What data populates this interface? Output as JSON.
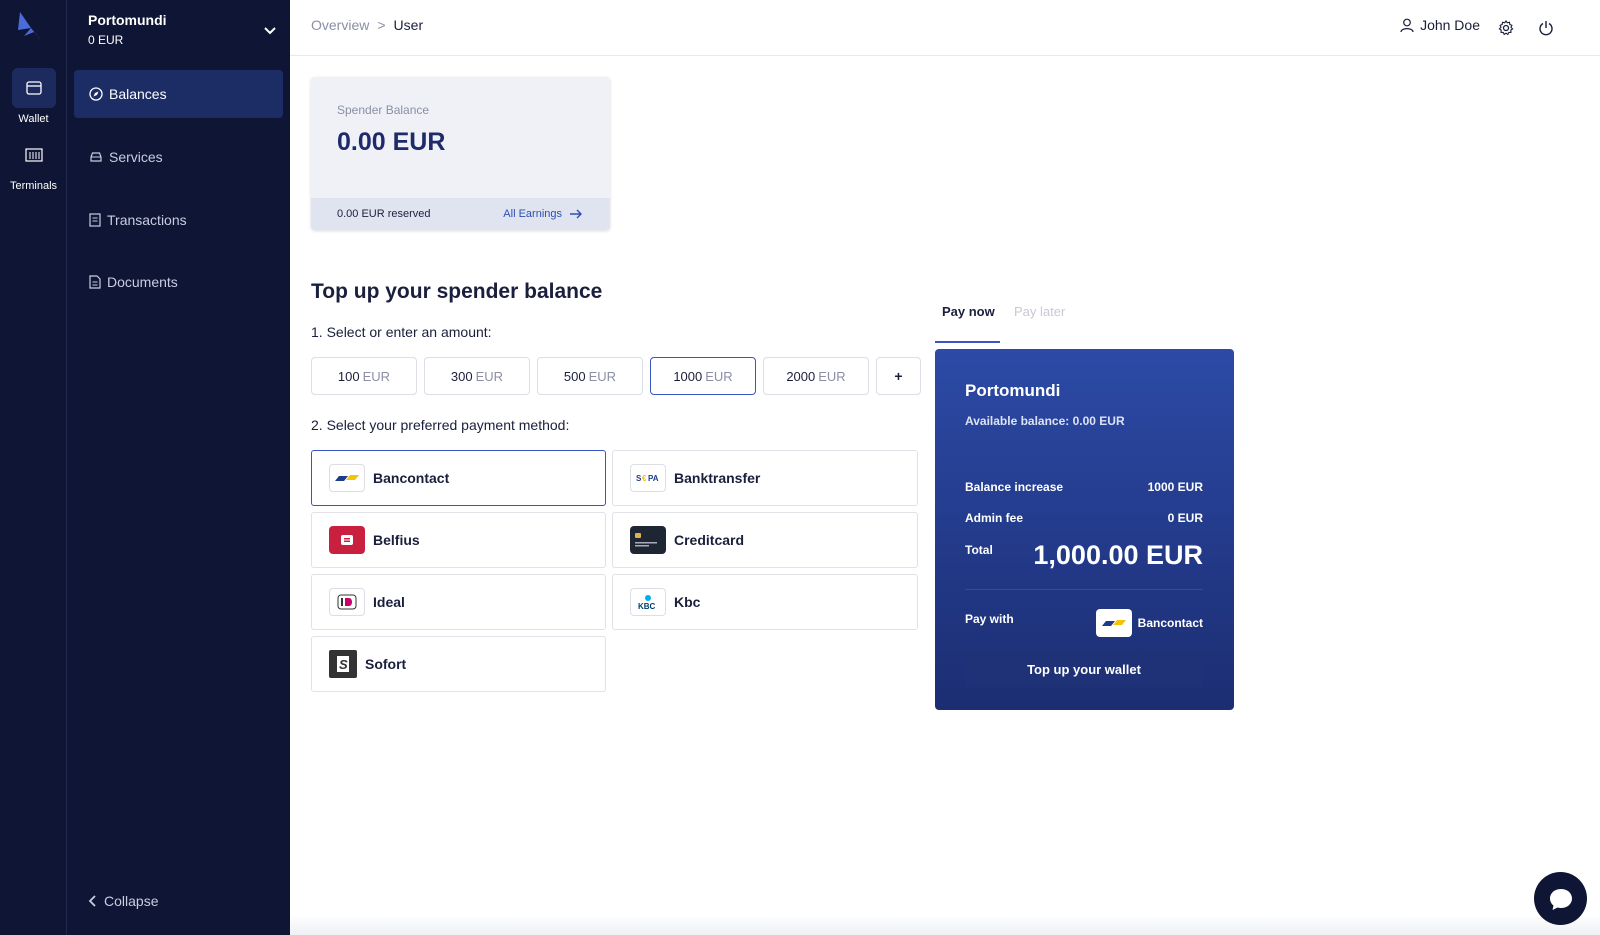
{
  "rail": {
    "items": [
      {
        "label": "Wallet",
        "icon": "wallet-icon"
      },
      {
        "label": "Terminals",
        "icon": "terminal-icon"
      }
    ]
  },
  "sidebar": {
    "org_name": "Portomundi",
    "org_balance": "0 EUR",
    "items": [
      {
        "label": "Balances",
        "icon": "compass-icon",
        "active": true
      },
      {
        "label": "Services",
        "icon": "car-icon"
      },
      {
        "label": "Transactions",
        "icon": "receipt-icon"
      },
      {
        "label": "Documents",
        "icon": "document-icon"
      }
    ],
    "collapse_label": "Collapse"
  },
  "header": {
    "breadcrumb": [
      "Overview",
      "User"
    ],
    "breadcrumb_sep": ">",
    "user_name": "John Doe"
  },
  "balance_card": {
    "label": "Spender Balance",
    "value": "0.00 EUR",
    "reserved": "0.00 EUR reserved",
    "earnings_link": "All Earnings"
  },
  "topup": {
    "title": "Top up your spender balance",
    "step1": "1. Select or enter an amount:",
    "currency": "EUR",
    "amounts": [
      "100",
      "300",
      "500",
      "1000",
      "2000"
    ],
    "selected_amount": "1000",
    "add_label": "+",
    "step2": "2. Select your preferred payment method:",
    "methods": [
      "Bancontact",
      "Banktransfer",
      "Belfius",
      "Creditcard",
      "Ideal",
      "Kbc",
      "Sofort"
    ],
    "selected_method": "Bancontact"
  },
  "pay_panel": {
    "tabs": [
      "Pay now",
      "Pay later"
    ],
    "title": "Portomundi",
    "available": "Available balance: 0.00 EUR",
    "balance_increase_label": "Balance increase",
    "balance_increase_value": "1000 EUR",
    "admin_fee_label": "Admin fee",
    "admin_fee_value": "0 EUR",
    "total_label": "Total",
    "total_value": "1,000.00 EUR",
    "pay_with_label": "Pay with",
    "pay_with_method": "Bancontact",
    "button": "Top up your wallet"
  },
  "colors": {
    "sidebar_bg": "#0f1535",
    "accent": "#3b54c4",
    "card_gradient_top": "#2c4aa6",
    "card_gradient_bottom": "#1c2d72"
  }
}
